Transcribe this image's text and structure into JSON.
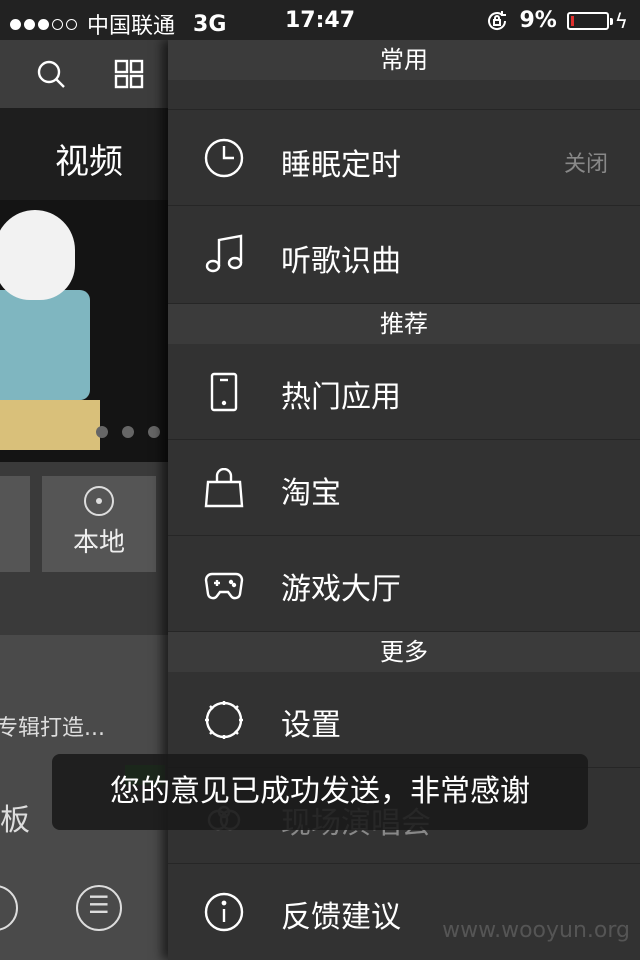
{
  "status_bar": {
    "carrier": "中国联通",
    "network": "3G",
    "time": "17:47",
    "battery": "9%",
    "battery_level": 0.09,
    "signal_bars_filled": 3,
    "signal_bars_total": 5
  },
  "background_app": {
    "section_title": "视频",
    "tile_label": "本地",
    "snippet_text": "专辑打造...",
    "snippet_text2": "板"
  },
  "drawer": {
    "sections": [
      {
        "label": "常用"
      },
      {
        "label": "推荐"
      },
      {
        "label": "更多"
      }
    ],
    "items": [
      {
        "label": "睡眠定时",
        "value": "关闭",
        "icon": "clock-icon"
      },
      {
        "label": "听歌识曲",
        "icon": "music-note-icon"
      },
      {
        "label": "热门应用",
        "icon": "phone-icon"
      },
      {
        "label": "淘宝",
        "icon": "shopping-bag-icon"
      },
      {
        "label": "游戏大厅",
        "icon": "gamepad-icon"
      },
      {
        "label": "设置",
        "icon": "gear-icon"
      },
      {
        "label": "现场演唱会",
        "icon": "concert-icon"
      },
      {
        "label": "反馈建议",
        "icon": "info-icon"
      }
    ]
  },
  "toast": {
    "message": "您的意见已成功发送，非常感谢"
  },
  "watermark": "www.wooyun.org"
}
